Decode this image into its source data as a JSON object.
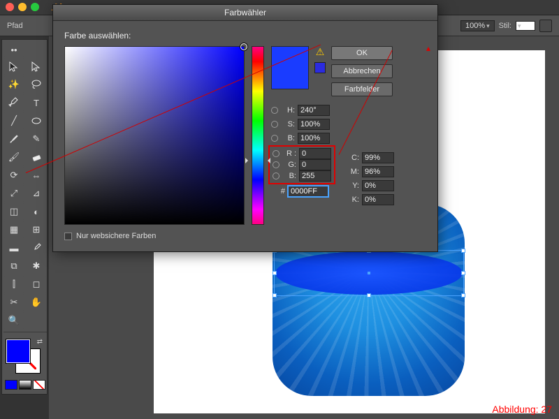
{
  "window": {
    "app_logo": "Ai"
  },
  "controlbar": {
    "path_label": "Pfad",
    "zoom": "100%",
    "style_label": "Stil:"
  },
  "dialog": {
    "title": "Farbwähler",
    "choose_label": "Farbe auswählen:",
    "ok": "OK",
    "cancel": "Abbrechen",
    "swatches": "Farbfelder",
    "websafe": "Nur websichere Farben",
    "hsb": {
      "h_label": "H:",
      "s_label": "S:",
      "b_label": "B:",
      "h": "240°",
      "s": "100%",
      "b": "100%"
    },
    "rgb": {
      "r_label": "R :",
      "g_label": "G:",
      "b_label": "B:",
      "r": "0",
      "g": "0",
      "b": "255"
    },
    "cmyk": {
      "c_label": "C:",
      "m_label": "M:",
      "y_label": "Y:",
      "k_label": "K:",
      "c": "99%",
      "m": "96%",
      "y": "0%",
      "k": "0%"
    },
    "hex_label": "#",
    "hex": "0000FF"
  },
  "caption": "Abbildung: 27",
  "chart_data": null
}
